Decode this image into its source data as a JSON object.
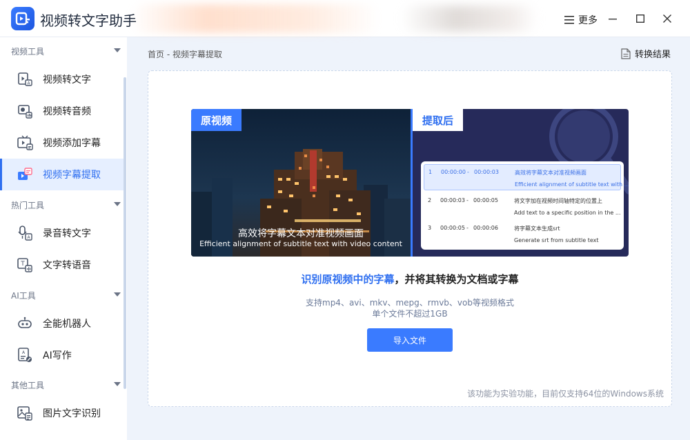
{
  "app": {
    "title": "视频转文字助手",
    "more_label": "更多",
    "accent": "#3a7bff"
  },
  "sidebar": {
    "sections": [
      {
        "label": "视频工具",
        "items": [
          {
            "label": "视频转文字",
            "icon": "video-text-icon"
          },
          {
            "label": "视频转音频",
            "icon": "video-audio-icon"
          },
          {
            "label": "视频添加字幕",
            "icon": "tv-subtitle-icon"
          },
          {
            "label": "视频字幕提取",
            "icon": "subtitle-extract-icon",
            "active": true
          }
        ]
      },
      {
        "label": "热门工具",
        "items": [
          {
            "label": "录音转文字",
            "icon": "mic-text-icon"
          },
          {
            "label": "文字转语音",
            "icon": "text-speech-icon"
          }
        ]
      },
      {
        "label": "AI工具",
        "items": [
          {
            "label": "全能机器人",
            "icon": "robot-icon"
          },
          {
            "label": "AI写作",
            "icon": "ai-write-icon"
          }
        ]
      },
      {
        "label": "其他工具",
        "items": [
          {
            "label": "图片文字识别",
            "icon": "image-ocr-icon"
          }
        ]
      }
    ]
  },
  "main": {
    "breadcrumb": "首页 - 视频字幕提取",
    "result_label": "转换结果",
    "preview": {
      "left_tag": "原视频",
      "right_tag": "提取后",
      "subtitle_cn": "高效将字幕文本对准视频画面",
      "subtitle_en": "Efficient alignment of subtitle text with video content",
      "rows": [
        {
          "idx": "1",
          "start": "00:00:00",
          "dash": "-",
          "end": "00:00:03",
          "cn": "高效将字幕文本对准视频画面",
          "en": "Efficient alignment of subtitle text with ..."
        },
        {
          "idx": "2",
          "start": "00:00:03",
          "dash": "-",
          "end": "00:00:05",
          "cn": "将文字加在视频时间轴特定的位置上",
          "en": "Add text to a specific position in the ..."
        },
        {
          "idx": "3",
          "start": "00:00:05",
          "dash": "-",
          "end": "00:00:06",
          "cn": "将字幕文本生成srt",
          "en": "Generate srt from subtitle text"
        }
      ]
    },
    "headline_highlight": "识别原视频中的字幕",
    "headline_rest": "，并将其转换为文档或字幕",
    "formats": "支持mp4、avi、mkv、mepg、rmvb、vob等视频格式",
    "size_limit": "单个文件不超过1GB",
    "import_label": "导入文件",
    "notice": "该功能为实验功能，目前仅支持64位的Windows系统"
  }
}
